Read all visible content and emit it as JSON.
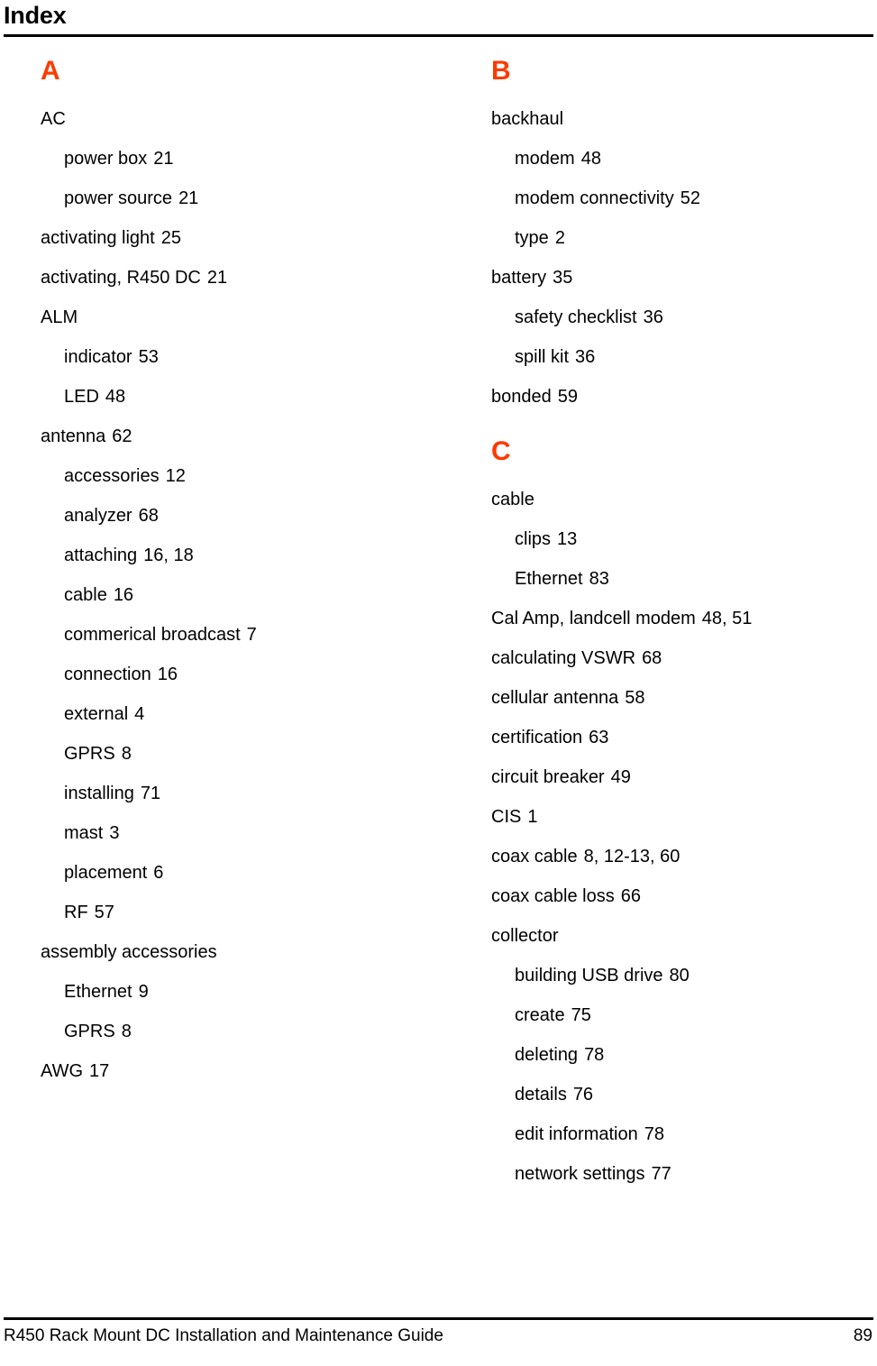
{
  "header": {
    "title": "Index",
    "rule": true
  },
  "theme": {
    "section_letter_color": "#FB3B00",
    "text_color": "#000000",
    "background": "#FFFFFF"
  },
  "columns": [
    {
      "id": "left-column",
      "sections": [
        {
          "letter": "A",
          "entries": [
            {
              "level": 1,
              "term": "AC",
              "pages": ""
            },
            {
              "level": 2,
              "term": "power box",
              "pages": "21"
            },
            {
              "level": 2,
              "term": "power source",
              "pages": "21"
            },
            {
              "level": 1,
              "term": "activating light",
              "pages": "25"
            },
            {
              "level": 1,
              "term": "activating, R450 DC",
              "pages": "21"
            },
            {
              "level": 1,
              "term": "ALM",
              "pages": ""
            },
            {
              "level": 2,
              "term": "indicator",
              "pages": "53"
            },
            {
              "level": 2,
              "term": "LED",
              "pages": "48"
            },
            {
              "level": 1,
              "term": "antenna",
              "pages": "62"
            },
            {
              "level": 2,
              "term": "accessories",
              "pages": "12"
            },
            {
              "level": 2,
              "term": "analyzer",
              "pages": "68"
            },
            {
              "level": 2,
              "term": "attaching",
              "pages": "16, 18"
            },
            {
              "level": 2,
              "term": "cable",
              "pages": "16"
            },
            {
              "level": 2,
              "term": "commerical broadcast",
              "pages": "7"
            },
            {
              "level": 2,
              "term": "connection",
              "pages": "16"
            },
            {
              "level": 2,
              "term": "external",
              "pages": "4"
            },
            {
              "level": 2,
              "term": "GPRS",
              "pages": "8"
            },
            {
              "level": 2,
              "term": "installing",
              "pages": "71"
            },
            {
              "level": 2,
              "term": "mast",
              "pages": "3"
            },
            {
              "level": 2,
              "term": "placement",
              "pages": "6"
            },
            {
              "level": 2,
              "term": "RF",
              "pages": "57"
            },
            {
              "level": 1,
              "term": "assembly accessories",
              "pages": ""
            },
            {
              "level": 2,
              "term": "Ethernet",
              "pages": "9"
            },
            {
              "level": 2,
              "term": "GPRS",
              "pages": "8"
            },
            {
              "level": 1,
              "term": "AWG",
              "pages": "17"
            }
          ]
        }
      ]
    },
    {
      "id": "right-column",
      "sections": [
        {
          "letter": "B",
          "entries": [
            {
              "level": 1,
              "term": "backhaul",
              "pages": ""
            },
            {
              "level": 2,
              "term": "modem",
              "pages": "48"
            },
            {
              "level": 2,
              "term": "modem connectivity",
              "pages": "52"
            },
            {
              "level": 2,
              "term": "type",
              "pages": "2"
            },
            {
              "level": 1,
              "term": "battery",
              "pages": "35"
            },
            {
              "level": 2,
              "term": "safety checklist",
              "pages": "36"
            },
            {
              "level": 2,
              "term": "spill kit",
              "pages": "36"
            },
            {
              "level": 1,
              "term": "bonded",
              "pages": "59"
            }
          ]
        },
        {
          "letter": "C",
          "entries": [
            {
              "level": 1,
              "term": "cable",
              "pages": ""
            },
            {
              "level": 2,
              "term": "clips",
              "pages": "13"
            },
            {
              "level": 2,
              "term": "Ethernet",
              "pages": "83"
            },
            {
              "level": 1,
              "term": "Cal Amp, landcell modem",
              "pages": "48, 51"
            },
            {
              "level": 1,
              "term": "calculating VSWR",
              "pages": "68"
            },
            {
              "level": 1,
              "term": "cellular antenna",
              "pages": "58"
            },
            {
              "level": 1,
              "term": "certification",
              "pages": "63"
            },
            {
              "level": 1,
              "term": "circuit breaker",
              "pages": "49"
            },
            {
              "level": 1,
              "term": "CIS",
              "pages": "1"
            },
            {
              "level": 1,
              "term": "coax cable",
              "pages": "8, 12-13, 60"
            },
            {
              "level": 1,
              "term": "coax cable loss",
              "pages": "66"
            },
            {
              "level": 1,
              "term": "collector",
              "pages": ""
            },
            {
              "level": 2,
              "term": "building USB drive",
              "pages": "80"
            },
            {
              "level": 2,
              "term": "create",
              "pages": "75"
            },
            {
              "level": 2,
              "term": "deleting",
              "pages": "78"
            },
            {
              "level": 2,
              "term": "details",
              "pages": "76"
            },
            {
              "level": 2,
              "term": "edit information",
              "pages": "78"
            },
            {
              "level": 2,
              "term": "network settings",
              "pages": "77"
            }
          ]
        }
      ]
    }
  ],
  "footer": {
    "document_title": "R450 Rack Mount DC Installation and Maintenance Guide",
    "page_number": "89",
    "rule": true
  }
}
